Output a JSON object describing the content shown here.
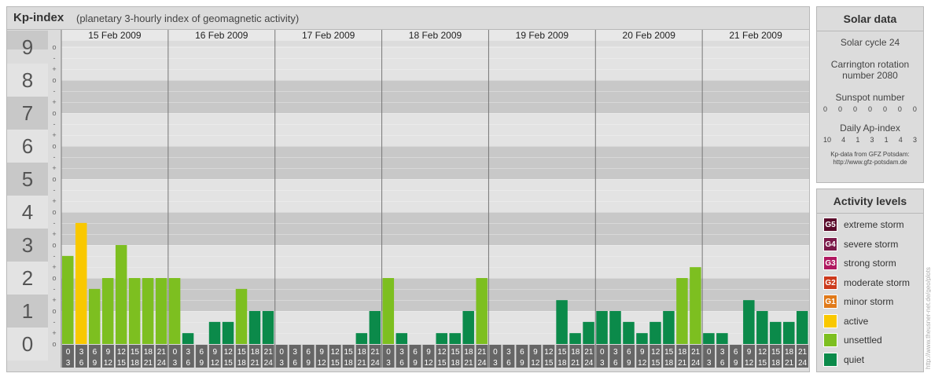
{
  "header": {
    "title": "Kp-index",
    "subtitle": "(planetary 3-hourly index of geomagnetic activity)"
  },
  "chart_data": {
    "type": "bar",
    "y_ticks": [
      "0",
      "1",
      "2",
      "3",
      "4",
      "5",
      "6",
      "7",
      "8",
      "9"
    ],
    "minor_ticks": [
      "o",
      "+",
      "-"
    ],
    "ylim": [
      0,
      9
    ],
    "days": [
      "15 Feb 2009",
      "16 Feb 2009",
      "17 Feb 2009",
      "18 Feb 2009",
      "19 Feb 2009",
      "20 Feb 2009",
      "21 Feb 2009"
    ],
    "interval_start": [
      "0",
      "3",
      "6",
      "9",
      "12",
      "15",
      "18",
      "21"
    ],
    "interval_end": [
      "3",
      "6",
      "9",
      "12",
      "15",
      "18",
      "21",
      "24"
    ],
    "values": [
      2.67,
      3.67,
      1.67,
      2.0,
      3.0,
      2.0,
      2.0,
      2.0,
      2.0,
      0.33,
      0.0,
      0.67,
      0.67,
      1.67,
      1.0,
      1.0,
      0.0,
      0.0,
      0.0,
      0.0,
      0.0,
      0.0,
      0.33,
      1.0,
      2.0,
      0.33,
      0.0,
      0.0,
      0.33,
      0.33,
      1.0,
      2.0,
      0.0,
      0.0,
      0.0,
      0.0,
      0.0,
      1.33,
      0.33,
      0.67,
      1.0,
      1.0,
      0.67,
      0.33,
      0.67,
      1.0,
      2.0,
      2.33,
      0.33,
      0.33,
      0.0,
      1.33,
      1.0,
      0.67,
      0.67,
      1.0
    ],
    "colors": {
      "quiet": "#0b8a4a",
      "unsettled": "#7dbf20",
      "active": "#f9c800"
    }
  },
  "solar": {
    "title": "Solar data",
    "cycle": "Solar cycle 24",
    "carrington_line1": "Carrington rotation",
    "carrington_line2": "number 2080",
    "sunspot_title": "Sunspot number",
    "sunspot": [
      "0",
      "0",
      "0",
      "0",
      "0",
      "0",
      "0"
    ],
    "ap_title": "Daily Ap-index",
    "ap": [
      "10",
      "4",
      "1",
      "3",
      "1",
      "4",
      "3"
    ],
    "credit1": "Kp-data from GFZ Potsdam:",
    "credit2": "http://www.gfz-potsdam.de"
  },
  "activity": {
    "title": "Activity levels",
    "levels": [
      {
        "code": "G5",
        "label": "extreme storm",
        "color": "#5a0a2a"
      },
      {
        "code": "G4",
        "label": "severe storm",
        "color": "#7a1848"
      },
      {
        "code": "G3",
        "label": "strong storm",
        "color": "#b01860"
      },
      {
        "code": "G2",
        "label": "moderate storm",
        "color": "#cc3a1c"
      },
      {
        "code": "G1",
        "label": "minor storm",
        "color": "#e07a1a"
      },
      {
        "code": "",
        "label": "active",
        "color": "#f9c800"
      },
      {
        "code": "",
        "label": "unsettled",
        "color": "#7dbf20"
      },
      {
        "code": "",
        "label": "quiet",
        "color": "#0b8a4a"
      }
    ]
  },
  "watermark": "http://www.theusner-net.de/geo/plots"
}
